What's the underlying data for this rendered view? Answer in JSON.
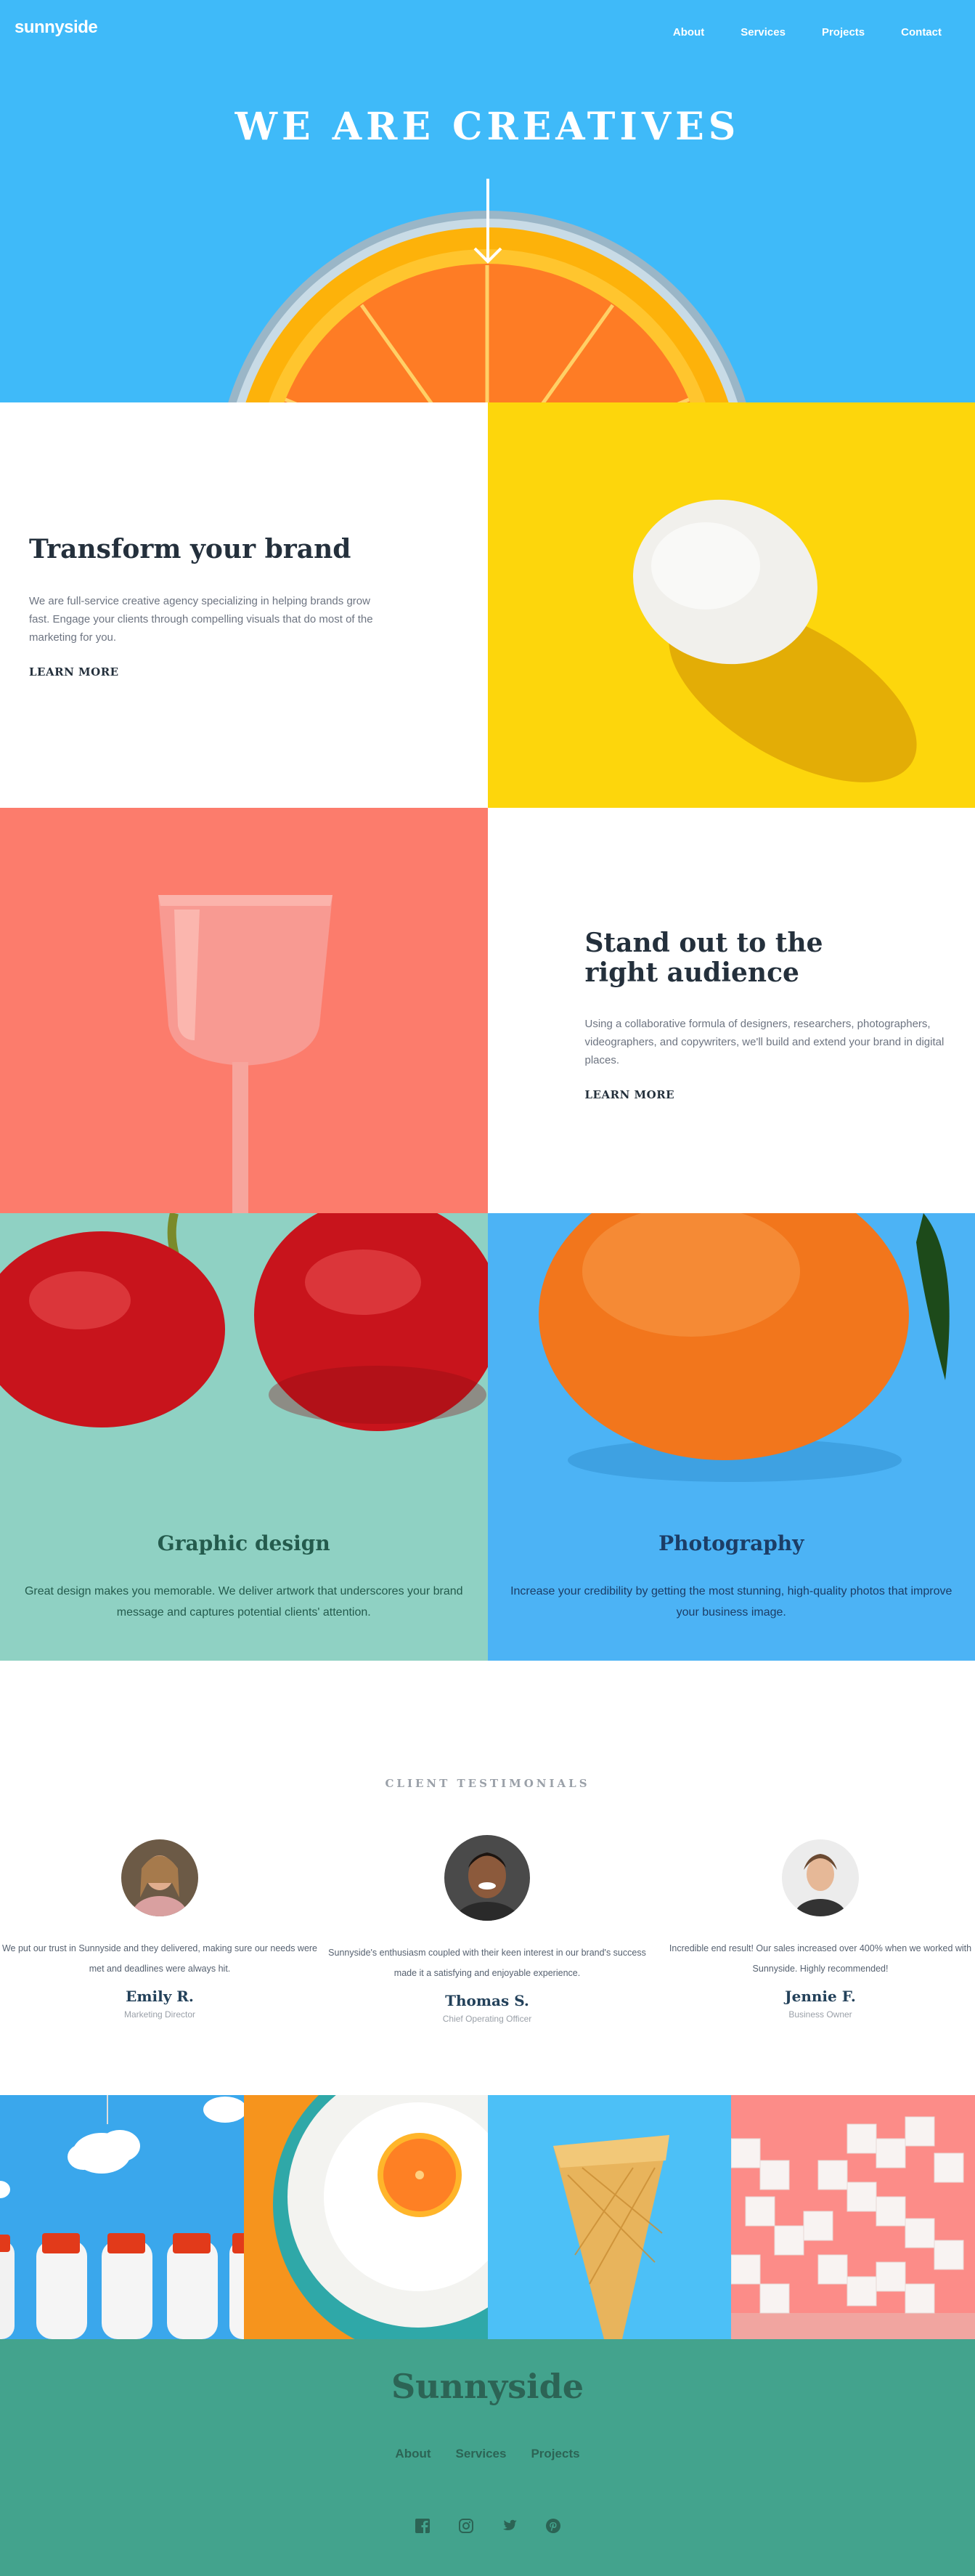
{
  "header": {
    "logo": "sunnyside",
    "nav": [
      "About",
      "Services",
      "Projects",
      "Contact"
    ]
  },
  "hero": {
    "title": "WE ARE CREATIVES"
  },
  "transform": {
    "title": "Transform your brand",
    "text": "We are full-service creative agency specializing in helping brands grow fast. Engage your clients through compelling visuals that do most of the marketing for you.",
    "link": "LEARN MORE"
  },
  "standout": {
    "title": "Stand out to the right audience",
    "text": "Using a collaborative formula of designers, researchers, photographers, videographers, and copywriters, we'll build and extend your brand in digital places.",
    "link": "LEARN MORE"
  },
  "services": [
    {
      "title": "Graphic design",
      "text": "Great design makes you memorable. We deliver artwork that underscores your brand message and captures potential clients' attention."
    },
    {
      "title": "Photography",
      "text": "Increase your credibility by getting the most stunning, high-quality photos that improve your business image."
    }
  ],
  "testimonials": {
    "heading": "CLIENT TESTIMONIALS",
    "items": [
      {
        "quote": "We put our trust in Sunnyside and they delivered, making sure our needs were met and deadlines were always hit.",
        "name": "Emily R.",
        "role": "Marketing Director"
      },
      {
        "quote": "Sunnyside's enthusiasm coupled with their keen interest in our brand's success made it a satisfying and enjoyable experience.",
        "name": "Thomas S.",
        "role": "Chief Operating Officer"
      },
      {
        "quote": "Incredible end result! Our sales increased over 400% when we worked with Sunnyside. Highly recommended!",
        "name": "Jennie F.",
        "role": "Business Owner"
      }
    ]
  },
  "footer": {
    "logo": "Sunnyside",
    "nav": [
      "About",
      "Services",
      "Projects"
    ],
    "social": [
      "facebook-icon",
      "instagram-icon",
      "twitter-icon",
      "pinterest-icon"
    ]
  },
  "colors": {
    "hero_blue": "#3fbaf9",
    "yellow": "#fdd60c",
    "coral": "#fc7c6c",
    "mint": "#8fd1c3",
    "footer_green": "#43a38d"
  }
}
